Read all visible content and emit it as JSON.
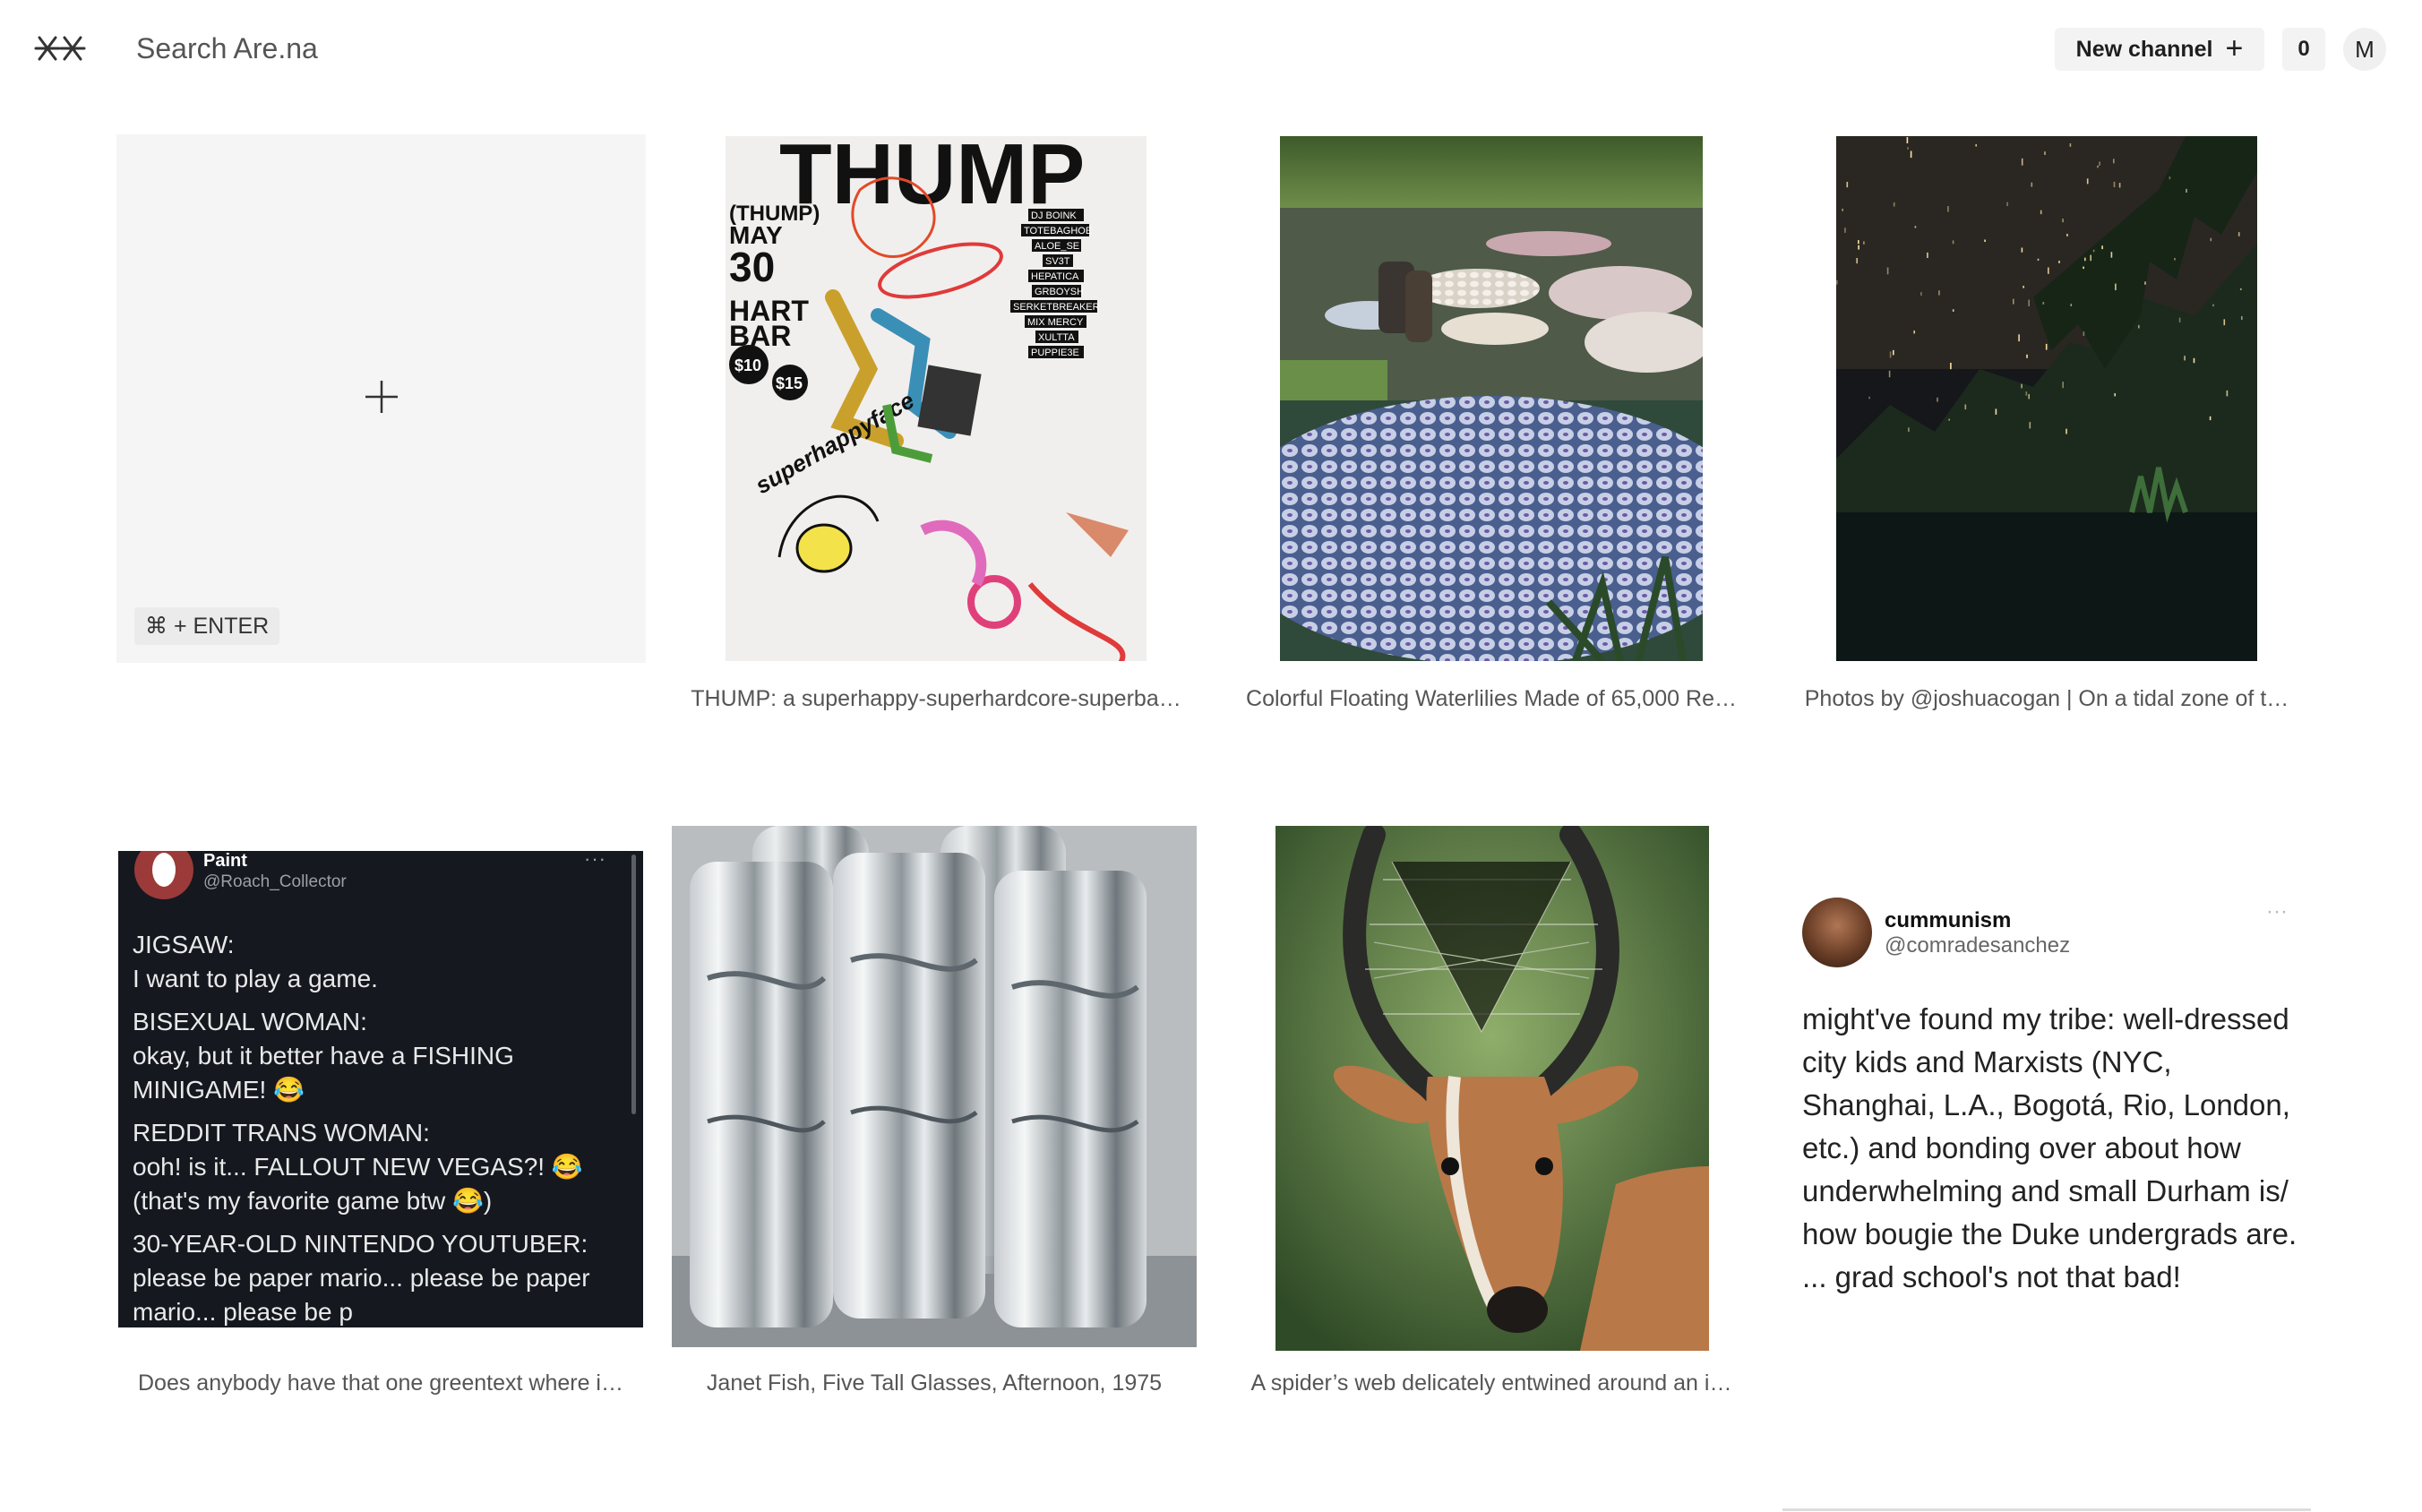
{
  "header": {
    "logo_icon": "arena-logo-icon",
    "search_placeholder": "Search Are.na",
    "new_channel_label": "New channel",
    "new_channel_icon": "plus-icon",
    "notification_count": "0",
    "avatar_initial": "M"
  },
  "new_block": {
    "icon": "plus-icon",
    "shortcut": "⌘ + ENTER"
  },
  "blocks": [
    {
      "type": "image",
      "caption": "THUMP: a superhappy-superhardcore-superba…"
    },
    {
      "type": "image",
      "caption": "Colorful Floating Waterlilies Made of 65,000 Re…"
    },
    {
      "type": "image",
      "caption": "Photos by @joshuacogan | On a tidal zone of t…"
    },
    {
      "type": "image",
      "caption": "Does anybody have that one greentext where i…"
    },
    {
      "type": "image",
      "caption": "Janet Fish, Five Tall Glasses, Afternoon, 1975"
    },
    {
      "type": "image",
      "caption": "A spider’s web delicately entwined around an i…"
    }
  ],
  "tweet_dark": {
    "name": "Paint",
    "handle": "@Roach_Collector",
    "more": "···",
    "lines": [
      "JIGSAW:",
      "I want to play a game.",
      "BISEXUAL WOMAN:",
      "okay, but it better have a FISHING MINIGAME! 😂",
      "REDDIT TRANS WOMAN:",
      "ooh! is it... FALLOUT NEW VEGAS?! 😂 (that's my favorite game btw 😂)",
      "30-YEAR-OLD NINTENDO YOUTUBER:",
      "please be paper mario... please be paper mario... please be p"
    ]
  },
  "tweet_light": {
    "name": "cummunism",
    "handle": "@comradesanchez",
    "more": "···",
    "text": "might've found my tribe: well-dressed city kids and Marxists (NYC, Shanghai, L.A., Bogotá, Rio, London, etc.) and bonding over about how underwhelming and small Durham is/ how bougie the Duke undergrads are. ... grad school's not that bad!"
  },
  "poster": {
    "title": "THUMP",
    "sub": "(THUMP)",
    "month": "MAY",
    "day": "30",
    "venue_1": "HART",
    "venue_2": "BAR",
    "price_1": "$10",
    "price_2": "$15",
    "lineup": [
      "DJ BOINK",
      "TOTEBAGHOE",
      "ALOE_SE",
      "SV3T",
      "HEPATICA",
      "GRBOYSH",
      "SERKETBREAKER",
      "MIX MERCY",
      "XULTTA",
      "PUPPIE3E"
    ],
    "brand": "superhappyface"
  },
  "colors": {
    "accent": "#1e1e1e",
    "placeholder_bg": "#f5f5f5",
    "button_bg": "#f3f3f3",
    "tweet_dark_bg": "#15181f"
  }
}
